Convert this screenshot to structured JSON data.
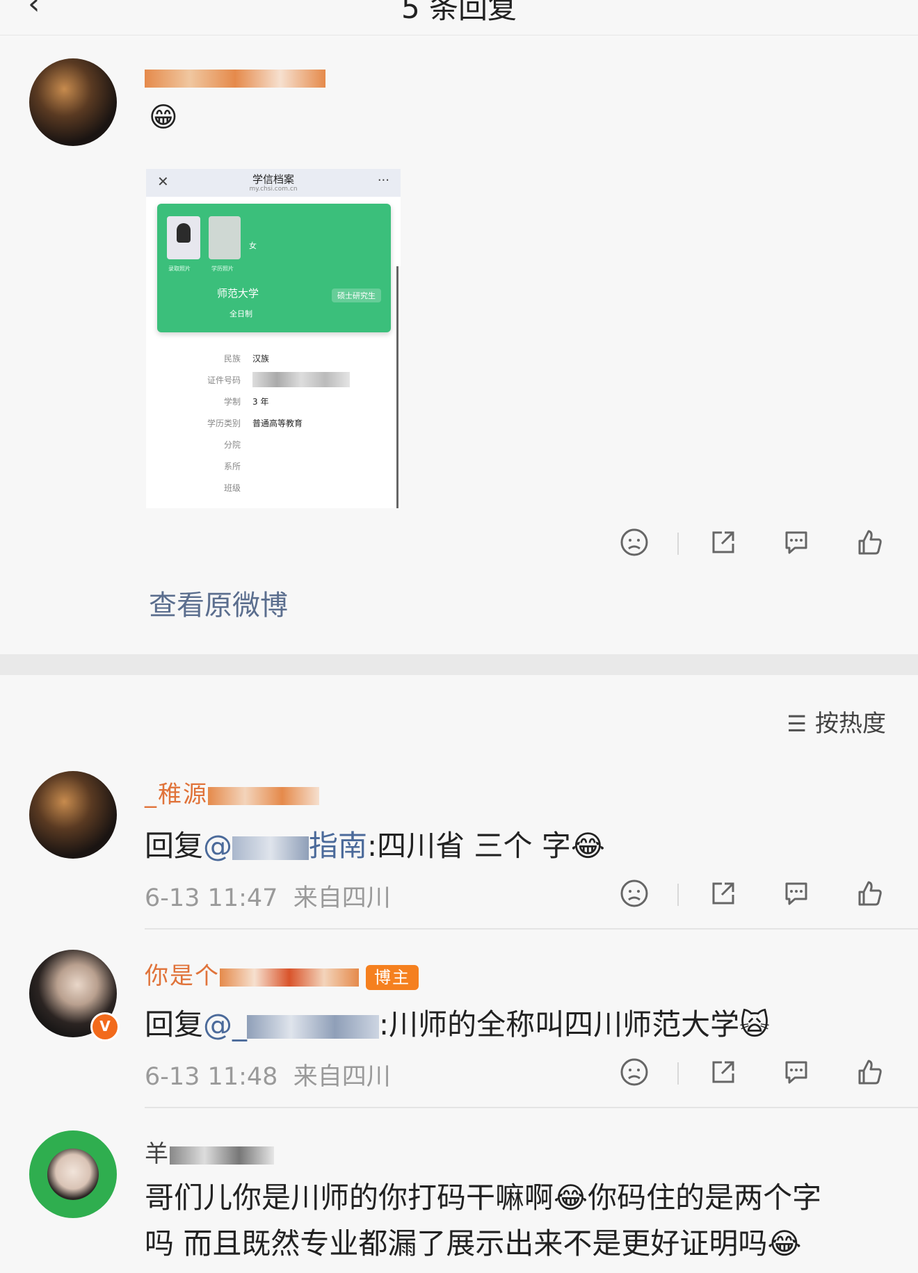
{
  "header": {
    "back_icon": "chevron-left-icon",
    "title": "5 条回复"
  },
  "post": {
    "emoji": "😁",
    "screenshot": {
      "close": "✕",
      "title": "学信档案",
      "url": "my.chsi.com.cn",
      "more": "···",
      "gender": "女",
      "photo_cap_1": "录取照片",
      "photo_cap_2": "学历照片",
      "school": "师范大学",
      "degree_badge": "硕士研究生",
      "study_mode": "全日制",
      "fields": [
        {
          "label": "民族",
          "value": "汉族"
        },
        {
          "label": "证件号码",
          "value": ""
        },
        {
          "label": "学制",
          "value": "3 年"
        },
        {
          "label": "学历类别",
          "value": "普通高等教育"
        },
        {
          "label": "分院",
          "value": ""
        },
        {
          "label": "系所",
          "value": ""
        },
        {
          "label": "班级",
          "value": ""
        }
      ]
    },
    "view_original": "查看原微博"
  },
  "sort_label": "按热度",
  "replies": [
    {
      "name": "_稚源",
      "prefix": "回复",
      "mention": "@",
      "mention_tail": "指南",
      "body": ":四川省 三个 字",
      "emoji": "😂",
      "time": "6-13 11:47",
      "location": "来自四川"
    },
    {
      "name": "你是个",
      "badge": "博主",
      "verified": "V",
      "prefix": "回复",
      "mention": "@_",
      "body": ":川师的全称叫四川师范大学",
      "emoji": "🙀",
      "time": "6-13 11:48",
      "location": "来自四川"
    },
    {
      "name": "羊",
      "line1": "哥们儿你是川师的你打码干嘛啊",
      "emoji1": "😂",
      "line1b": "你码住的是两个字",
      "line2": "吗 而且既然专业都漏了展示出来不是更好证明吗",
      "emoji2": "😂"
    }
  ],
  "colors": {
    "name": "#e0733a",
    "link": "#4b6a9a",
    "badge": "#f5801f",
    "verified": "#f26a1b"
  }
}
